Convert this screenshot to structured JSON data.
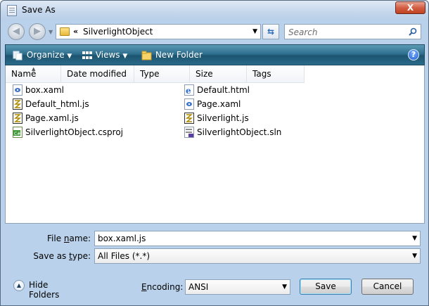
{
  "window": {
    "title": "Save As",
    "close_label": "X"
  },
  "nav": {
    "back_glyph": "◀",
    "forward_glyph": "▶",
    "address_prefix": "«",
    "address_path": "SilverlightObject",
    "search_placeholder": "Search"
  },
  "commandbar": {
    "organize": "Organize",
    "views": "Views",
    "new_folder": "New Folder",
    "help": "?"
  },
  "columns": [
    "Name",
    "Date modified",
    "Type",
    "Size",
    "Tags"
  ],
  "files": [
    {
      "name": "box.xaml",
      "icon": "xaml-file-icon"
    },
    {
      "name": "Default_html.js",
      "icon": "js-file-icon"
    },
    {
      "name": "Page.xaml.js",
      "icon": "js-file-icon"
    },
    {
      "name": "SilverlightObject.csproj",
      "icon": "csproj-file-icon"
    },
    {
      "name": "Default.html",
      "icon": "html-file-icon"
    },
    {
      "name": "Page.xaml",
      "icon": "xaml-file-icon"
    },
    {
      "name": "Silverlight.js",
      "icon": "js-file-icon"
    },
    {
      "name": "SilverlightObject.sln",
      "icon": "sln-file-icon"
    }
  ],
  "form": {
    "file_name_label_a": "File ",
    "file_name_label_u": "n",
    "file_name_label_b": "ame:",
    "file_name_value": "box.xaml.js",
    "save_type_label_a": "Save as ",
    "save_type_label_u": "t",
    "save_type_label_b": "ype:",
    "save_type_value": "All Files  (*.*)",
    "hide_folders": "Hide Folders",
    "encoding_label_u": "E",
    "encoding_label_b": "ncoding:",
    "encoding_value": "ANSI",
    "save_button": "Save",
    "cancel_button": "Cancel"
  },
  "colors": {
    "accent": "#2f6f8e",
    "window_bg": "#b9d1ea"
  }
}
